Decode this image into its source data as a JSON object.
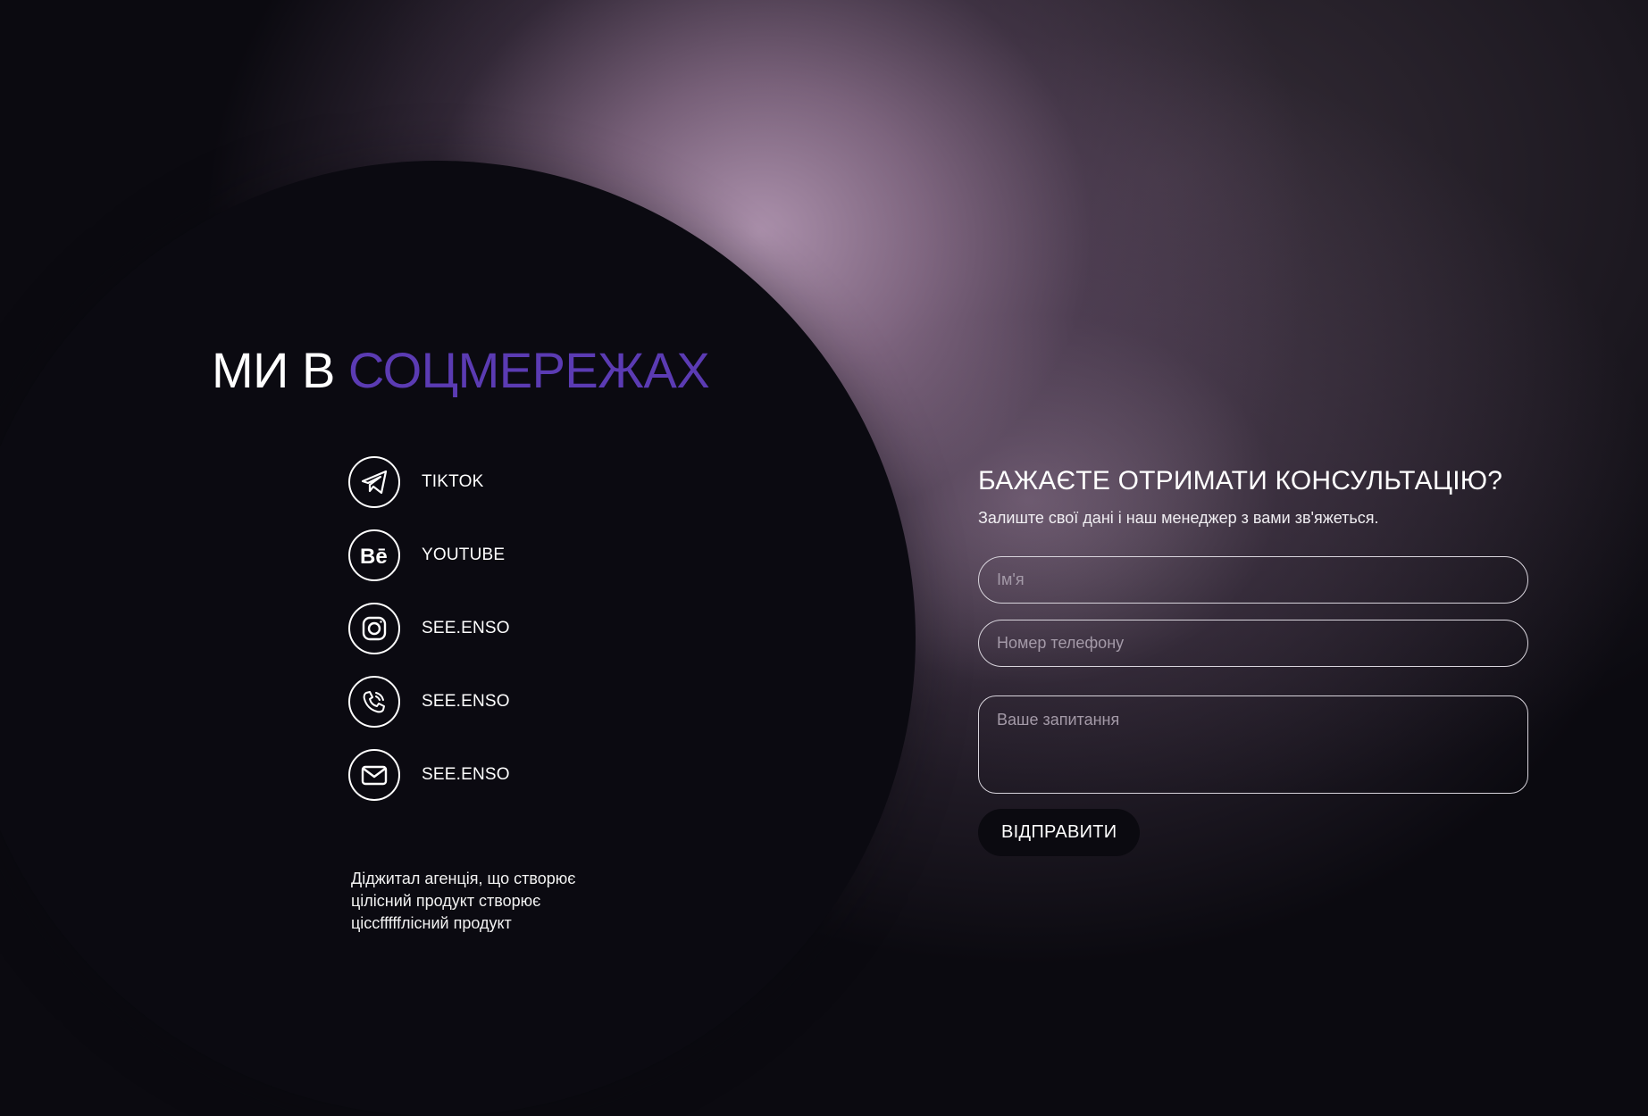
{
  "social": {
    "title_prefix": "МИ В",
    "title_accent": "СОЦМЕРЕЖАХ",
    "accent_color": "#5b3bb3",
    "items": [
      {
        "icon": "telegram-icon",
        "label": "TIKTOK"
      },
      {
        "icon": "behance-icon",
        "label": "YOUTUBE"
      },
      {
        "icon": "instagram-icon",
        "label": "SEE.ENSO"
      },
      {
        "icon": "phone-icon",
        "label": "SEE.ENSO"
      },
      {
        "icon": "mail-icon",
        "label": "SEE.ENSO"
      }
    ]
  },
  "about": {
    "line1": "Діджитал агенція, що створює",
    "line2": "цілісний продукт створює",
    "line3": "ціссfffffлісний продукт"
  },
  "form": {
    "title": "БАЖАЄТЕ ОТРИМАТИ КОНСУЛЬТАЦІЮ?",
    "subtitle": "Залиште свої дані і наш менеджер з вами зв'яжеться.",
    "name_placeholder": "Ім'я",
    "phone_placeholder": "Номер телефону",
    "question_placeholder": "Ваше запитання",
    "submit_label": "ВІДПРАВИТИ"
  }
}
